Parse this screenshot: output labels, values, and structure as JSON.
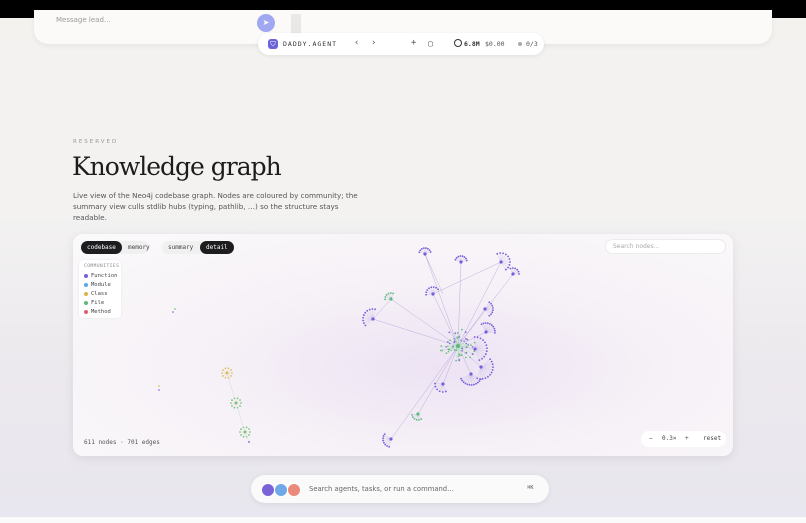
{
  "composer": {
    "placeholder": "Message lead..."
  },
  "agent_bar": {
    "name": "DADDY.AGENT",
    "tokens": "6.8M",
    "cost": "$0.00",
    "count": "0/3"
  },
  "section": {
    "eyebrow": "RESERVED",
    "title": "Knowledge graph",
    "description": "Live view of the Neo4j codebase graph. Nodes are coloured by community; the summary view culls stdlib hubs (typing, pathlib, …) so the structure stays readable."
  },
  "graph": {
    "source_tabs": [
      "codebase",
      "memory"
    ],
    "view_tabs": [
      "summary",
      "detail"
    ],
    "active_source": "codebase",
    "active_view": "detail",
    "search_placeholder": "Search nodes…",
    "legend_title": "COMMUNITIES",
    "legend": [
      {
        "label": "Function",
        "color": "#7b5cdc"
      },
      {
        "label": "Module",
        "color": "#5aa9e6"
      },
      {
        "label": "Class",
        "color": "#d9b44a"
      },
      {
        "label": "File",
        "color": "#5dbb7a"
      },
      {
        "label": "Method",
        "color": "#e0606a"
      }
    ],
    "stats": "611 nodes · 701 edges",
    "zoom_minus": "−",
    "zoom_level": "0.3×",
    "zoom_plus": "+",
    "zoom_reset": "reset"
  },
  "command_bar": {
    "placeholder": "Search agents, tasks, or run a command…",
    "shortcut": "⌘K"
  }
}
